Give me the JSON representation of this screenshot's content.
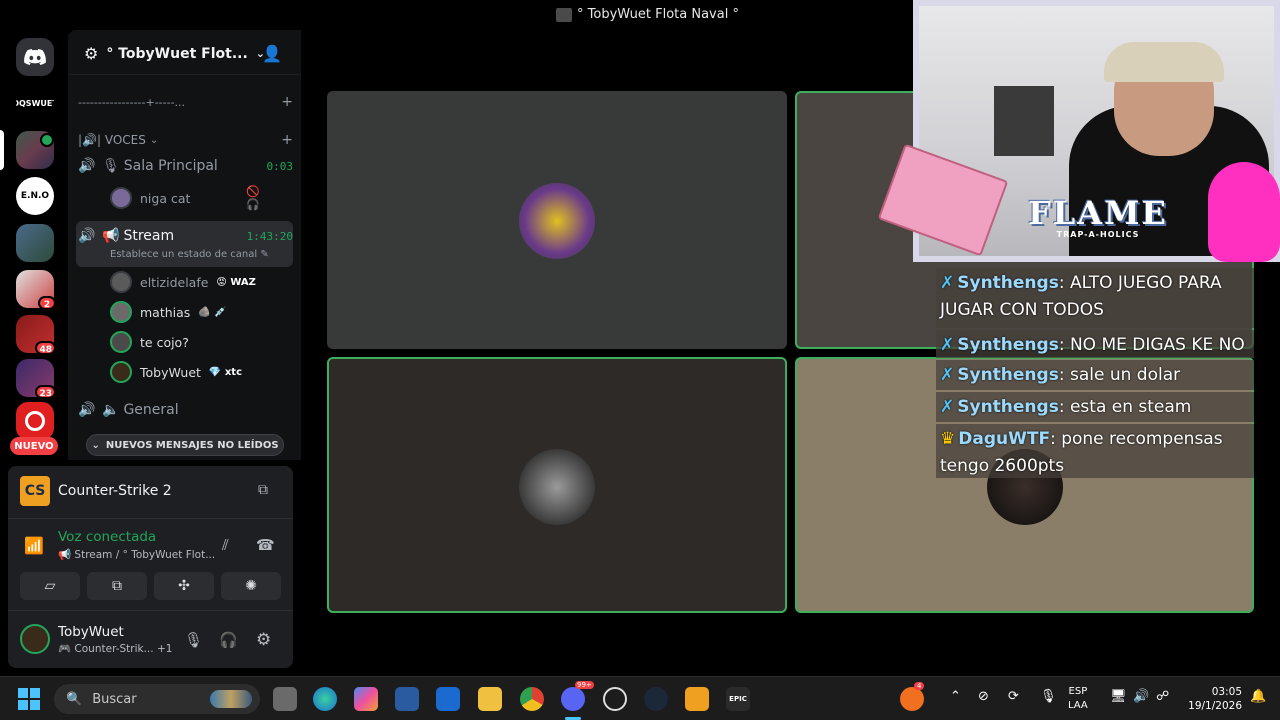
{
  "window": {
    "title": "° TobyWuet Flota Naval °"
  },
  "rail": {
    "dm_icon": "discord-logo-icon",
    "servers": [
      {
        "label": "OQSWUET",
        "badge": ""
      },
      {
        "label": "",
        "badge": ""
      },
      {
        "label": "E.N.O",
        "badge": ""
      },
      {
        "label": "",
        "badge": ""
      },
      {
        "label": "",
        "badge": "2"
      },
      {
        "label": "",
        "badge": "48"
      },
      {
        "label": "",
        "badge": "23"
      },
      {
        "label": "",
        "badge": ""
      }
    ],
    "new_label": "NUEVO"
  },
  "sidebar": {
    "server_name": "° TobyWuet Flot...",
    "divider_text": "-----------------+-----...",
    "voice_category": "|🔊| VOCES",
    "channels": {
      "sala_principal": {
        "name": "Sala Principal",
        "timer": "0:03"
      },
      "stream": {
        "name": "Stream",
        "timer": "1:43:20",
        "status": "Establece un estado de canal"
      },
      "general": {
        "name": "General"
      }
    },
    "sala_users": [
      {
        "name": "niga cat"
      }
    ],
    "stream_users": [
      {
        "name": "eltizidelafe",
        "tag": "WAZ"
      },
      {
        "name": "mathias",
        "tag": ""
      },
      {
        "name": "te cojo?",
        "tag": ""
      },
      {
        "name": "TobyWuet",
        "tag": "xtc"
      }
    ],
    "new_messages": "NUEVOS MENSAJES NO LEÍDOS"
  },
  "panel": {
    "game": "Counter-Strike 2",
    "voice_status": "Voz conectada",
    "voice_channel": "Stream / ° TobyWuet Flot...",
    "user": {
      "name": "TobyWuet",
      "activity": "Counter-Strik...",
      "extra": "+1"
    }
  },
  "overlay": {
    "brand": "FLAME",
    "brand_sub": "TRAP-A-HOLICS",
    "chat": [
      {
        "user": "Synthengs",
        "text": ": ALTO JUEGO PARA JUGAR CON TODOS"
      },
      {
        "user": "Synthengs",
        "text": ": NO ME DIGAS KE NO"
      },
      {
        "user": "Synthengs",
        "text": ": sale un dolar"
      },
      {
        "user": "Synthengs",
        "text": ": esta en steam"
      },
      {
        "user": "DaguWTF",
        "text": ": pone recompensas tengo 2600pts"
      }
    ]
  },
  "taskbar": {
    "search_placeholder": "Buscar",
    "lang_line1": "ESP",
    "lang_line2": "LAA",
    "time": "03:05",
    "date": "19/1/2026",
    "notif_count": "4",
    "discord_badge": "99+"
  },
  "colors": {
    "green": "#23a55a",
    "bg": "#000000",
    "sidebar": "#111214",
    "accent": "#5865f2"
  }
}
